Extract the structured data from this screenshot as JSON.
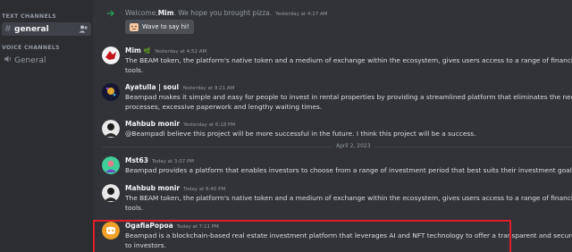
{
  "sidebar": {
    "text_channels_label": "TEXT CHANNELS",
    "general_label": "general",
    "voice_channels_label": "VOICE CHANNELS",
    "voice_general_label": "General"
  },
  "welcome": {
    "prefix": "Welcome, ",
    "user": "Mim",
    "suffix": ". We hope you brought pizza.",
    "timestamp": "Yesterday at 4:17 AM",
    "wave_button": "Wave to say hi!"
  },
  "divider_date": "April 2, 2023",
  "messages": [
    {
      "author": "Mim",
      "author_badge": "🌿",
      "timestamp": "Yesterday at 4:52 AM",
      "lines": [
        "The BEAM token, the platform's native token and a medium of exchange within the ecosystem, gives users access to a range of financial services and analytic",
        "tools."
      ]
    },
    {
      "author": "Ayatulla | soul",
      "timestamp": "Yesterday at 9:21 AM",
      "lines": [
        "Beampad makes it simple and easy for people to invest in rental properties by providing a streamlined platform that eliminates the need for complicated",
        "processes, excessive paperwork and lengthy waiting times."
      ]
    },
    {
      "author": "Mahbub monir",
      "timestamp": "Yesterday at 6:18 PM",
      "lines": [
        "@Beampadl believe this project will be more successful in the future. I think this project will be a success."
      ]
    },
    {
      "author": "Mst63",
      "timestamp": "Today at 3:07 PM",
      "lines": [
        "Beampad provides a platform that enables investors to choose from a range of investment period that best suits their investment goals and risk tolerance."
      ]
    },
    {
      "author": "Mahbub monir",
      "timestamp": "Today at 6:40 PM",
      "lines": [
        "The BEAM token, the platform's native token and a medium of exchange within the ecosystem, gives users access to a range of financial services and analytic",
        "tools."
      ]
    },
    {
      "author": "OgafiaPopoa",
      "timestamp": "Today at 7:11 PM",
      "lines": [
        "Beampad is a blockchain-based real estate investment platform that leverages AI and NFT technology to offer a transparent and secure investment ecosyste",
        "to investors."
      ]
    }
  ],
  "colors": {
    "highlight_border": "#e01e2b",
    "join_arrow": "#23a559",
    "discord_blurple_avatar": "#f0a028"
  }
}
